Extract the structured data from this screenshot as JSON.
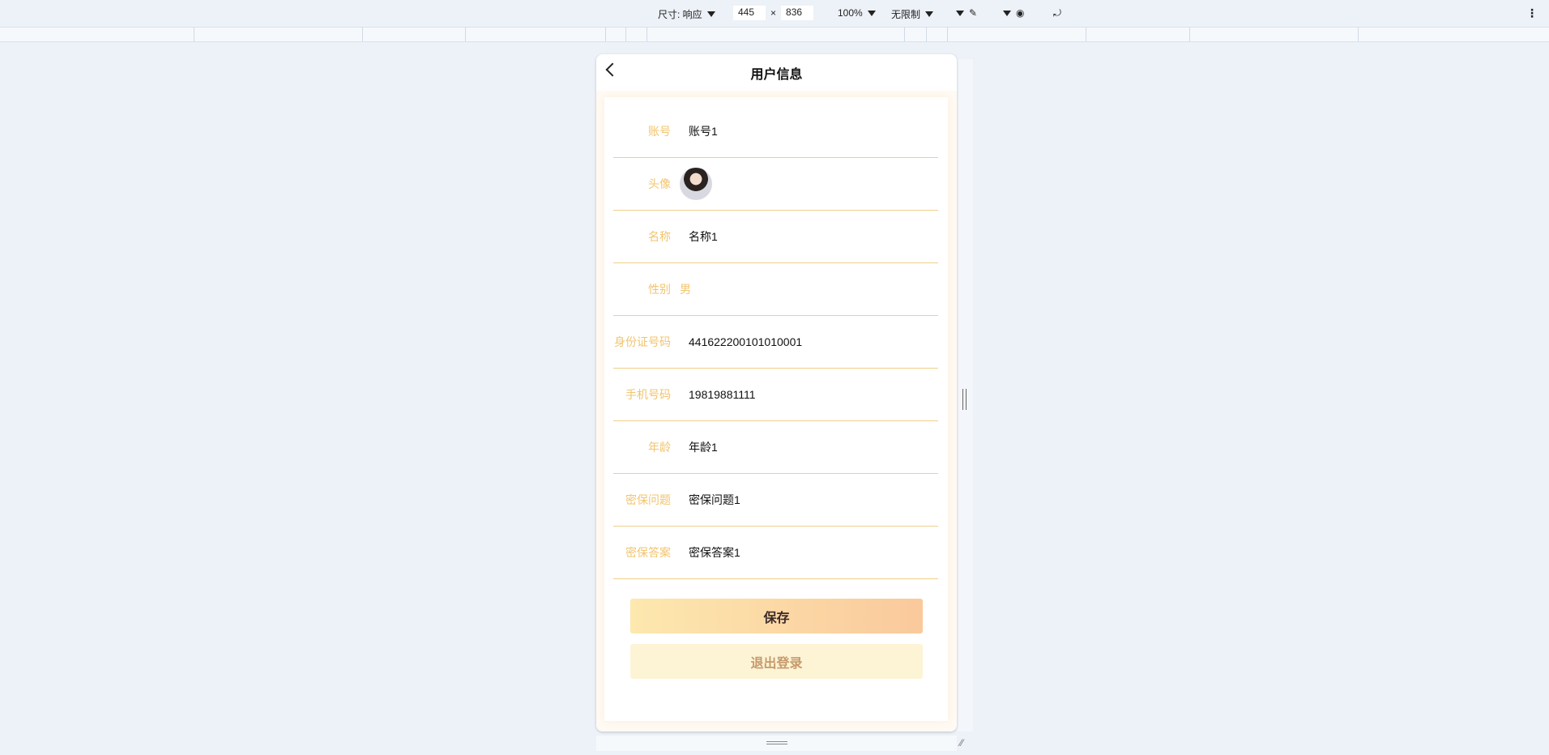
{
  "devtools": {
    "size_label": "尺寸: 响应",
    "width": "445",
    "height": "836",
    "times": "×",
    "zoom": "100%",
    "throttle": "无限制"
  },
  "page": {
    "title": "用户信息"
  },
  "fields": [
    {
      "label": "账号",
      "value": "账号1"
    },
    {
      "label": "头像",
      "value": ""
    },
    {
      "label": "名称",
      "value": "名称1"
    },
    {
      "label": "性别",
      "value": "男"
    },
    {
      "label": "身份证号码",
      "value": "441622200101010001"
    },
    {
      "label": "手机号码",
      "value": "19819881111"
    },
    {
      "label": "年龄",
      "value": "年龄1"
    },
    {
      "label": "密保问题",
      "value": "密保问题1"
    },
    {
      "label": "密保答案",
      "value": "密保答案1"
    }
  ],
  "buttons": {
    "save": "保存",
    "logout": "退出登录"
  },
  "colors": {
    "label": "#f2c46e",
    "divider": "#f0d08a",
    "save_from": "#fde8ae",
    "save_to": "#fac99c",
    "logout_bg": "#fdf4d6"
  }
}
